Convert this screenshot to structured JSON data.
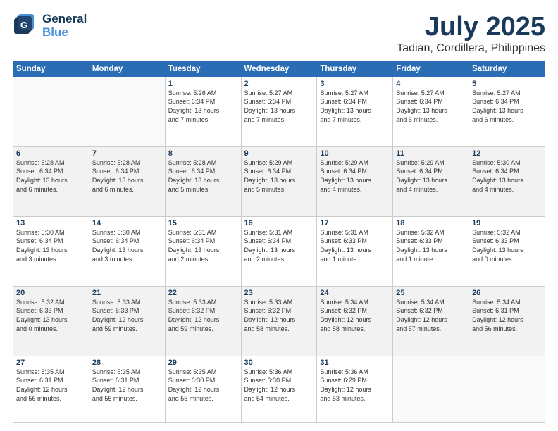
{
  "logo": {
    "line1": "General",
    "line2": "Blue"
  },
  "header": {
    "month": "July 2025",
    "location": "Tadian, Cordillera, Philippines"
  },
  "weekdays": [
    "Sunday",
    "Monday",
    "Tuesday",
    "Wednesday",
    "Thursday",
    "Friday",
    "Saturday"
  ],
  "weeks": [
    [
      {
        "day": "",
        "detail": ""
      },
      {
        "day": "",
        "detail": ""
      },
      {
        "day": "1",
        "detail": "Sunrise: 5:26 AM\nSunset: 6:34 PM\nDaylight: 13 hours\nand 7 minutes."
      },
      {
        "day": "2",
        "detail": "Sunrise: 5:27 AM\nSunset: 6:34 PM\nDaylight: 13 hours\nand 7 minutes."
      },
      {
        "day": "3",
        "detail": "Sunrise: 5:27 AM\nSunset: 6:34 PM\nDaylight: 13 hours\nand 7 minutes."
      },
      {
        "day": "4",
        "detail": "Sunrise: 5:27 AM\nSunset: 6:34 PM\nDaylight: 13 hours\nand 6 minutes."
      },
      {
        "day": "5",
        "detail": "Sunrise: 5:27 AM\nSunset: 6:34 PM\nDaylight: 13 hours\nand 6 minutes."
      }
    ],
    [
      {
        "day": "6",
        "detail": "Sunrise: 5:28 AM\nSunset: 6:34 PM\nDaylight: 13 hours\nand 6 minutes."
      },
      {
        "day": "7",
        "detail": "Sunrise: 5:28 AM\nSunset: 6:34 PM\nDaylight: 13 hours\nand 6 minutes."
      },
      {
        "day": "8",
        "detail": "Sunrise: 5:28 AM\nSunset: 6:34 PM\nDaylight: 13 hours\nand 5 minutes."
      },
      {
        "day": "9",
        "detail": "Sunrise: 5:29 AM\nSunset: 6:34 PM\nDaylight: 13 hours\nand 5 minutes."
      },
      {
        "day": "10",
        "detail": "Sunrise: 5:29 AM\nSunset: 6:34 PM\nDaylight: 13 hours\nand 4 minutes."
      },
      {
        "day": "11",
        "detail": "Sunrise: 5:29 AM\nSunset: 6:34 PM\nDaylight: 13 hours\nand 4 minutes."
      },
      {
        "day": "12",
        "detail": "Sunrise: 5:30 AM\nSunset: 6:34 PM\nDaylight: 13 hours\nand 4 minutes."
      }
    ],
    [
      {
        "day": "13",
        "detail": "Sunrise: 5:30 AM\nSunset: 6:34 PM\nDaylight: 13 hours\nand 3 minutes."
      },
      {
        "day": "14",
        "detail": "Sunrise: 5:30 AM\nSunset: 6:34 PM\nDaylight: 13 hours\nand 3 minutes."
      },
      {
        "day": "15",
        "detail": "Sunrise: 5:31 AM\nSunset: 6:34 PM\nDaylight: 13 hours\nand 2 minutes."
      },
      {
        "day": "16",
        "detail": "Sunrise: 5:31 AM\nSunset: 6:34 PM\nDaylight: 13 hours\nand 2 minutes."
      },
      {
        "day": "17",
        "detail": "Sunrise: 5:31 AM\nSunset: 6:33 PM\nDaylight: 13 hours\nand 1 minute."
      },
      {
        "day": "18",
        "detail": "Sunrise: 5:32 AM\nSunset: 6:33 PM\nDaylight: 13 hours\nand 1 minute."
      },
      {
        "day": "19",
        "detail": "Sunrise: 5:32 AM\nSunset: 6:33 PM\nDaylight: 13 hours\nand 0 minutes."
      }
    ],
    [
      {
        "day": "20",
        "detail": "Sunrise: 5:32 AM\nSunset: 6:33 PM\nDaylight: 13 hours\nand 0 minutes."
      },
      {
        "day": "21",
        "detail": "Sunrise: 5:33 AM\nSunset: 6:33 PM\nDaylight: 12 hours\nand 59 minutes."
      },
      {
        "day": "22",
        "detail": "Sunrise: 5:33 AM\nSunset: 6:32 PM\nDaylight: 12 hours\nand 59 minutes."
      },
      {
        "day": "23",
        "detail": "Sunrise: 5:33 AM\nSunset: 6:32 PM\nDaylight: 12 hours\nand 58 minutes."
      },
      {
        "day": "24",
        "detail": "Sunrise: 5:34 AM\nSunset: 6:32 PM\nDaylight: 12 hours\nand 58 minutes."
      },
      {
        "day": "25",
        "detail": "Sunrise: 5:34 AM\nSunset: 6:32 PM\nDaylight: 12 hours\nand 57 minutes."
      },
      {
        "day": "26",
        "detail": "Sunrise: 5:34 AM\nSunset: 6:31 PM\nDaylight: 12 hours\nand 56 minutes."
      }
    ],
    [
      {
        "day": "27",
        "detail": "Sunrise: 5:35 AM\nSunset: 6:31 PM\nDaylight: 12 hours\nand 56 minutes."
      },
      {
        "day": "28",
        "detail": "Sunrise: 5:35 AM\nSunset: 6:31 PM\nDaylight: 12 hours\nand 55 minutes."
      },
      {
        "day": "29",
        "detail": "Sunrise: 5:35 AM\nSunset: 6:30 PM\nDaylight: 12 hours\nand 55 minutes."
      },
      {
        "day": "30",
        "detail": "Sunrise: 5:36 AM\nSunset: 6:30 PM\nDaylight: 12 hours\nand 54 minutes."
      },
      {
        "day": "31",
        "detail": "Sunrise: 5:36 AM\nSunset: 6:29 PM\nDaylight: 12 hours\nand 53 minutes."
      },
      {
        "day": "",
        "detail": ""
      },
      {
        "day": "",
        "detail": ""
      }
    ]
  ]
}
